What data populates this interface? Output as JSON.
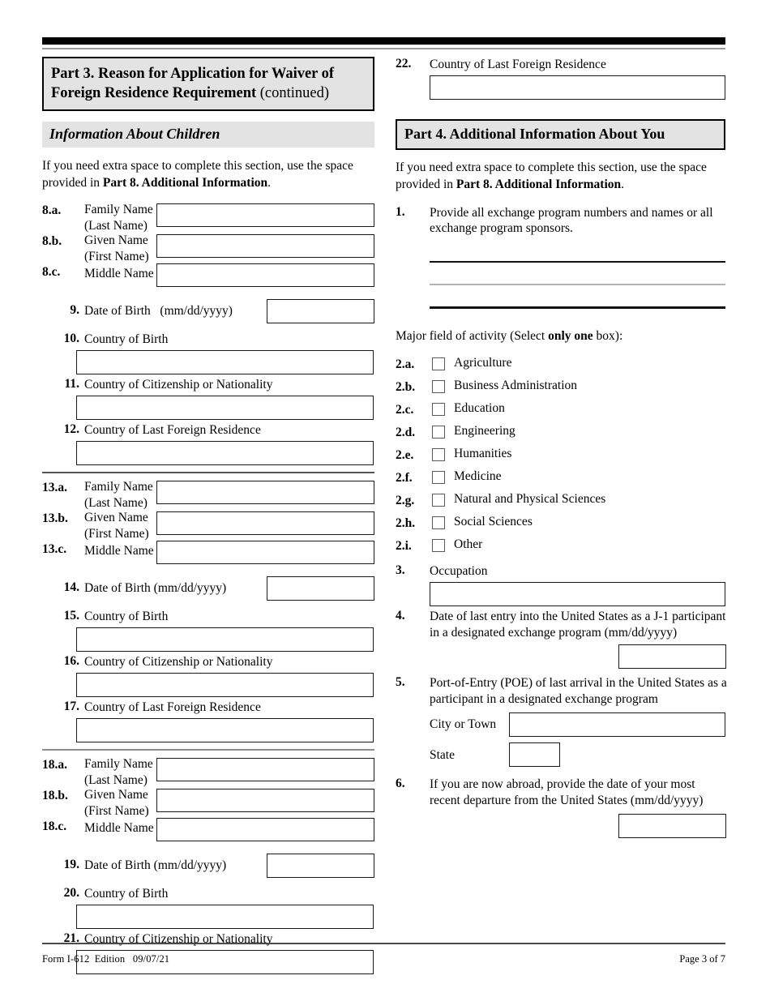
{
  "document": {
    "form_number": "Form I-612  Edition   09/07/21",
    "page_label": "Page 3 of 7"
  },
  "part3": {
    "header_main": "Part 3.  Reason for Application for Waiver of Foreign Residence Requirement",
    "header_suffix": " (continued)",
    "subsection": "Information About Children",
    "instruction_prefix": "If you need extra space to complete this section, use the space provided in ",
    "instruction_bold": "Part 8. Additional Information",
    "instruction_suffix": ".",
    "children": [
      {
        "family_num": "8.a.",
        "family_label_1": "Family Name",
        "family_label_2": "(Last Name)",
        "given_num": "8.b.",
        "given_label_1": "Given Name",
        "given_label_2": "(First Name)",
        "middle_num": "8.c.",
        "middle_label": "Middle Name",
        "dob_num": "9.",
        "dob_label": "Date of Birth   (mm/dd/yyyy)",
        "birth_num": "10.",
        "birth_label": "Country of Birth",
        "citizen_num": "11.",
        "citizen_label": "Country of Citizenship or Nationality",
        "residence_num": "12.",
        "residence_label": "Country of Last Foreign Residence"
      },
      {
        "family_num": "13.a.",
        "family_label_1": "Family Name",
        "family_label_2": "(Last Name)",
        "given_num": "13.b.",
        "given_label_1": "Given Name",
        "given_label_2": "(First Name)",
        "middle_num": "13.c.",
        "middle_label": "Middle Name",
        "dob_num": "14.",
        "dob_label": "Date of Birth (mm/dd/yyyy)",
        "birth_num": "15.",
        "birth_label": "Country of Birth",
        "citizen_num": "16.",
        "citizen_label": "Country of Citizenship or Nationality",
        "residence_num": "17.",
        "residence_label": "Country of Last Foreign Residence"
      },
      {
        "family_num": "18.a.",
        "family_label_1": "Family Name",
        "family_label_2": "(Last Name)",
        "given_num": "18.b.",
        "given_label_1": "Given Name",
        "given_label_2": "(First Name)",
        "middle_num": "18.c.",
        "middle_label": "Middle Name",
        "dob_num": "19.",
        "dob_label": "Date of Birth (mm/dd/yyyy)",
        "birth_num": "20.",
        "birth_label": "Country of Birth",
        "citizen_num": "21.",
        "citizen_label": "Country of Citizenship or Nationality",
        "residence_num": "22.",
        "residence_label": "Country of Last Foreign Residence"
      }
    ]
  },
  "part4": {
    "header": "Part 4.  Additional Information About You",
    "instruction_prefix": "If you need extra space to complete this section, use the space provided in ",
    "instruction_bold": "Part 8. Additional Information",
    "instruction_suffix": ".",
    "item1": {
      "num": "1.",
      "text": "Provide all exchange program numbers and names or all exchange program sponsors."
    },
    "item2": {
      "prompt_prefix": "Major field of activity (Select ",
      "prompt_bold": "only one",
      "prompt_suffix": " box):",
      "options": [
        {
          "num": "2.a.",
          "label": "Agriculture"
        },
        {
          "num": "2.b.",
          "label": "Business Administration"
        },
        {
          "num": "2.c.",
          "label": "Education"
        },
        {
          "num": "2.d.",
          "label": "Engineering"
        },
        {
          "num": "2.e.",
          "label": "Humanities"
        },
        {
          "num": "2.f.",
          "label": "Medicine"
        },
        {
          "num": "2.g.",
          "label": "Natural and Physical Sciences"
        },
        {
          "num": "2.h.",
          "label": "Social Sciences"
        },
        {
          "num": "2.i.",
          "label": "Other"
        }
      ]
    },
    "item3": {
      "num": "3.",
      "label": "Occupation"
    },
    "item4": {
      "num": "4.",
      "text": "Date of last entry into the United States as a J-1 participant in a designated exchange program (mm/dd/yyyy)"
    },
    "item5": {
      "num": "5.",
      "text": "Port-of-Entry (POE) of last arrival in the United States as a participant in a designated exchange program",
      "city_label": "City or Town",
      "state_label": "State"
    },
    "item6": {
      "num": "6.",
      "text": "If you are now abroad, provide the date of your most recent departure from the United States (mm/dd/yyyy)"
    }
  }
}
